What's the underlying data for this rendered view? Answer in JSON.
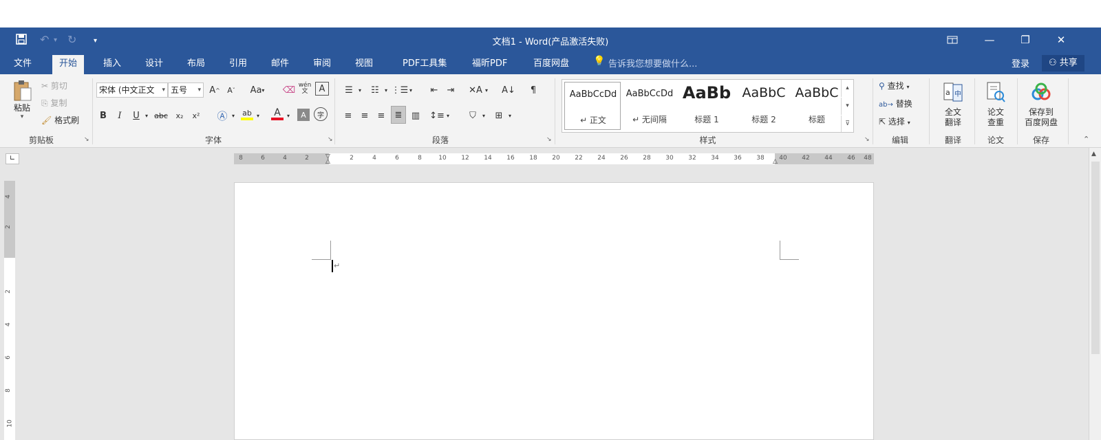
{
  "window": {
    "title": "文档1 - Word(产品激活失败)",
    "controls": [
      "ribbon-display-options",
      "minimize",
      "restore",
      "close"
    ]
  },
  "qat": {
    "save": "save-icon",
    "undo": "undo-icon",
    "redo": "redo-icon",
    "customize": "dropdown-icon"
  },
  "tabs": [
    "文件",
    "开始",
    "插入",
    "设计",
    "布局",
    "引用",
    "邮件",
    "审阅",
    "视图",
    "PDF工具集",
    "福昕PDF",
    "百度网盘"
  ],
  "active_tab": "开始",
  "tell_me": "告诉我您想要做什么...",
  "account": {
    "login": "登录",
    "share": "共享"
  },
  "clipboard": {
    "label": "剪贴板",
    "paste": "粘贴",
    "cut": "剪切",
    "copy": "复制",
    "format_painter": "格式刷"
  },
  "font": {
    "label": "字体",
    "font_name": "宋体 (中文正文",
    "font_size": "五号",
    "case": "Aa",
    "bold": "B",
    "italic": "I",
    "underline": "U",
    "strike": "abc",
    "subscript": "x₂",
    "superscript": "x²",
    "font_color": "A",
    "highlight": "ab",
    "char_shading": "A",
    "enclose": "字",
    "phonetic": "wén\n文",
    "border": "A"
  },
  "paragraph": {
    "label": "段落"
  },
  "styles": {
    "label": "样式",
    "items": [
      {
        "preview": "AaBbCcDd",
        "name": "↵ 正文"
      },
      {
        "preview": "AaBbCcDd",
        "name": "↵ 无间隔"
      },
      {
        "preview": "AaBb",
        "name": "标题 1"
      },
      {
        "preview": "AaBbC",
        "name": "标题 2"
      },
      {
        "preview": "AaBbC",
        "name": "标题"
      }
    ]
  },
  "editing": {
    "label": "编辑",
    "find": "查找",
    "replace": "替换",
    "select": "选择"
  },
  "translate": {
    "label": "翻译",
    "button": "全文\n翻译"
  },
  "thesis": {
    "label": "论文",
    "button": "论文\n查重"
  },
  "save_group": {
    "label": "保存",
    "button": "保存到\n百度网盘"
  },
  "colors": {
    "brand": "#2b579a",
    "ribbon_bg": "#f3f3f3",
    "workspace_bg": "#e6e6e6",
    "font_color_bar": "#e81123",
    "highlight_bar": "#ffff00"
  },
  "ruler": {
    "h_ticks_left": [
      "8",
      "6",
      "4",
      "2"
    ],
    "h_ticks": [
      "2",
      "4",
      "6",
      "8",
      "10",
      "12",
      "14",
      "16",
      "18",
      "20",
      "22",
      "24",
      "26",
      "28",
      "30",
      "32",
      "34",
      "36",
      "38",
      "40",
      "42",
      "44",
      "46",
      "48"
    ],
    "v_ticks": [
      "4",
      "2",
      "2",
      "4",
      "6",
      "8",
      "10"
    ]
  }
}
